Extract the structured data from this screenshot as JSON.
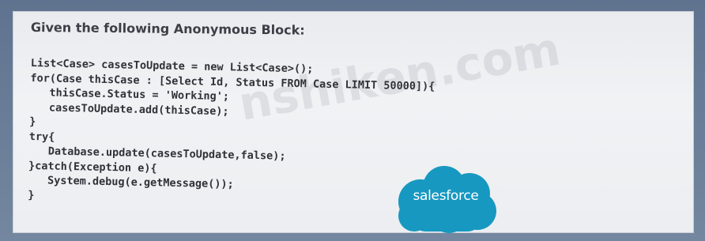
{
  "heading": "Given the following Anonymous Block:",
  "code_lines": [
    "List<Case> casesToUpdate = new List<Case>();",
    "for(Case thisCase : [Select Id, Status FROM Case LIMIT 50000]){",
    "   thisCase.Status = 'Working';",
    "   casesToUpdate.add(thisCase);",
    "}",
    "try{",
    "   Database.update(casesToUpdate,false);",
    "}catch(Exception e){",
    "   System.debug(e.getMessage());",
    "}"
  ],
  "watermark": "nshiken.com",
  "logo": {
    "text": "salesforce",
    "color": "#1798c1"
  }
}
